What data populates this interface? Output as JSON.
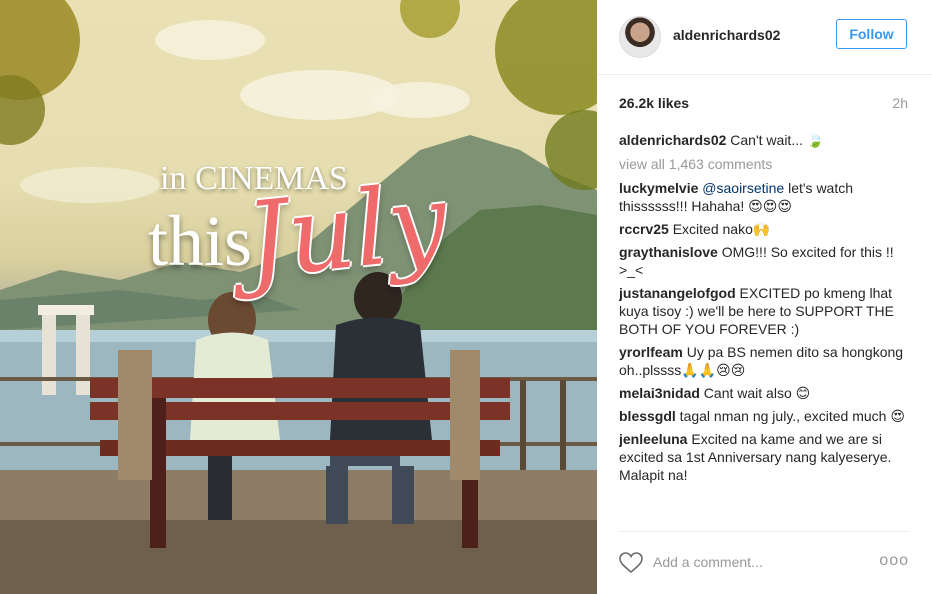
{
  "photo": {
    "overlay_line1": "in CINEMAS",
    "overlay_line2": "this",
    "overlay_script": "July"
  },
  "post": {
    "username": "aldenrichards02",
    "follow_label": "Follow",
    "likes": "26.2k likes",
    "time_ago": "2h",
    "caption": {
      "user": "aldenrichards02",
      "text": "Can't wait...",
      "emoji": "🍃"
    },
    "view_all_label": "view all 1,463 comments"
  },
  "comments": [
    {
      "user": "luckymelvie",
      "mention": "@saoirsetine",
      "text": " let's watch thissssss!!! Hahaha! 😍😍😍"
    },
    {
      "user": "rccrv25",
      "mention": "",
      "text": " Excited nako🙌"
    },
    {
      "user": "graythanislove",
      "mention": "",
      "text": " OMG!!! So excited for this !! >_<"
    },
    {
      "user": "justanangelofgod",
      "mention": "",
      "text": " EXCITED po kmeng lhat kuya tisoy :) we'll be here to SUPPORT THE BOTH OF YOU FOREVER :)"
    },
    {
      "user": "yrorlfeam",
      "mention": "",
      "text": " Uy pa BS nemen dito sa hongkong oh..plssss🙏🙏😢😢"
    },
    {
      "user": "melai3nidad",
      "mention": "",
      "text": " Cant wait also 😊"
    },
    {
      "user": "blessgdl",
      "mention": "",
      "text": " tagal nman ng july., excited much 😍"
    },
    {
      "user": "jenleeluna",
      "mention": "",
      "text": " Excited na kame and we are si excited sa 1st Anniversary nang kalyeserye. Malapit na!"
    }
  ],
  "footer": {
    "comment_placeholder": "Add a comment...",
    "more_label": "ooo"
  },
  "colors": {
    "accent": "#3897f0",
    "muted": "#999999",
    "text": "#262626",
    "script_red": "#ef6a6a"
  }
}
